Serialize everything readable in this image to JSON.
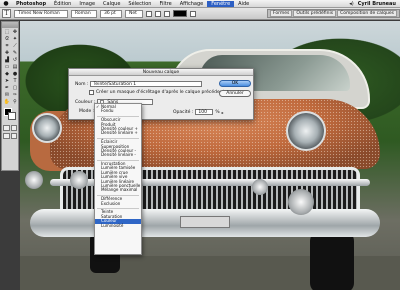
{
  "menubar": {
    "apple": "",
    "app_name": "Photoshop",
    "menus": [
      "Édition",
      "Image",
      "Calque",
      "Sélection",
      "Filtre",
      "Affichage",
      "Fenêtre",
      "Aide"
    ],
    "active_menu_index": 6,
    "user": "Cyril Bruneau"
  },
  "options_bar": {
    "tool_icon": "T",
    "font_family": "Times New Roman",
    "font_style": "Roman",
    "font_size": "36 pt",
    "antialias": "Net",
    "palette_tabs": [
      "Formes",
      "Outils prédéfinis",
      "Composition de calques"
    ]
  },
  "dialog": {
    "title": "Nouveau calque",
    "name_label": "Nom :",
    "name_value": "Teinte/Saturation 1",
    "ok_label": "OK",
    "clip_label": "Créer un masque d'écrêtage d'après le calque précédent",
    "cancel_label": "Annuler",
    "color_label": "Couleur :",
    "color_value": "Sans",
    "mode_label": "Mode :",
    "opacity_label": "Opacité :",
    "opacity_value": "100",
    "opacity_unit": "%"
  },
  "mode_menu": {
    "items": [
      {
        "label": "Normal",
        "checked": true
      },
      {
        "label": "Fondu"
      },
      {
        "sep": true
      },
      {
        "label": "Obscurcir"
      },
      {
        "label": "Produit"
      },
      {
        "label": "Densité couleur +"
      },
      {
        "label": "Densité linéaire +"
      },
      {
        "sep": true
      },
      {
        "label": "Éclaircir"
      },
      {
        "label": "Superposition"
      },
      {
        "label": "Densité couleur -"
      },
      {
        "label": "Densité linéaire -"
      },
      {
        "sep": true
      },
      {
        "label": "Incrustation"
      },
      {
        "label": "Lumière tamisée"
      },
      {
        "label": "Lumière crue"
      },
      {
        "label": "Lumière vive"
      },
      {
        "label": "Lumière linéaire"
      },
      {
        "label": "Lumière ponctuelle"
      },
      {
        "label": "Mélange maximal"
      },
      {
        "sep": true
      },
      {
        "label": "Différence"
      },
      {
        "label": "Exclusion"
      },
      {
        "sep": true
      },
      {
        "label": "Teinte"
      },
      {
        "label": "Saturation"
      },
      {
        "label": "Couleur",
        "selected": true
      },
      {
        "label": "Luminosité"
      }
    ]
  },
  "colors": {
    "menu_highlight": "#2f66c6",
    "car_body": "#c06a3d"
  }
}
